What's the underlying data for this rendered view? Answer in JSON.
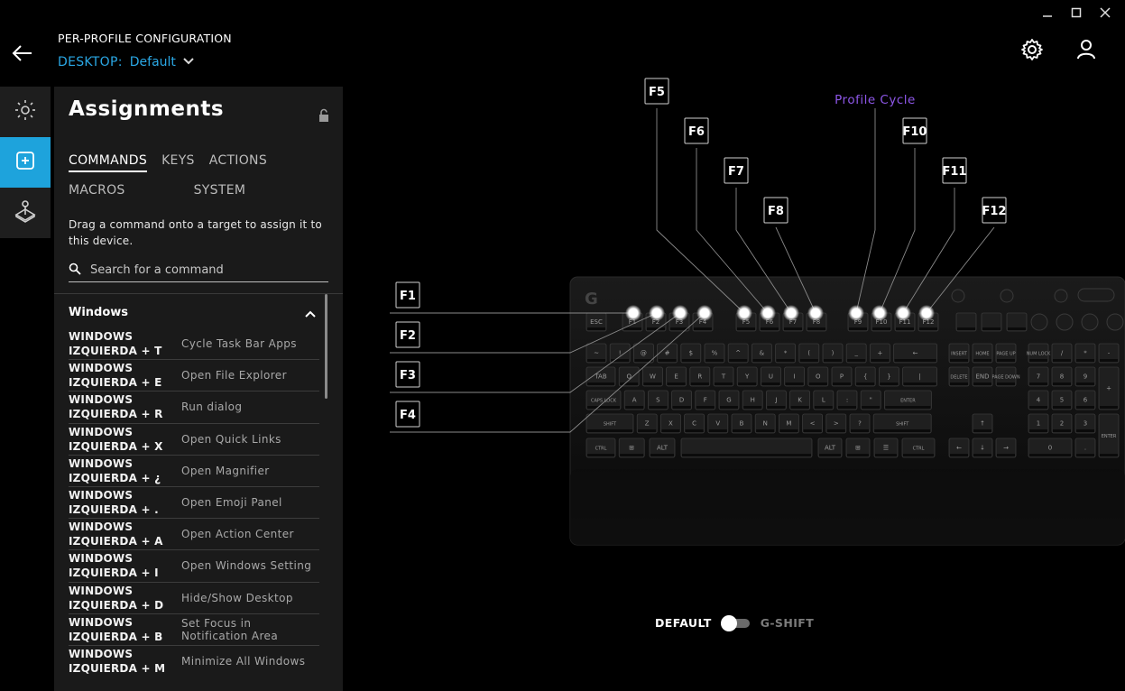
{
  "window": {
    "minimize_icon": "minimize-icon",
    "maximize_icon": "maximize-icon",
    "close_icon": "close-icon"
  },
  "header": {
    "title": "PER-PROFILE CONFIGURATION",
    "profile_prefix": "DESKTOP:",
    "profile_name": "Default",
    "accent_color": "#2aa7e4"
  },
  "sidebar": {
    "items": [
      {
        "name": "lighting",
        "icon": "sun-icon",
        "active": false
      },
      {
        "name": "assignments",
        "icon": "plus-square-icon",
        "active": true
      },
      {
        "name": "game-mode",
        "icon": "joystick-icon",
        "active": false
      }
    ],
    "active_color": "#1ea3dc"
  },
  "assignments": {
    "title": "Assignments",
    "tabs": [
      {
        "label": "COMMANDS",
        "active": true
      },
      {
        "label": "KEYS",
        "active": false
      },
      {
        "label": "ACTIONS",
        "active": false
      },
      {
        "label": "MACROS",
        "active": false
      },
      {
        "label": "SYSTEM",
        "active": false
      }
    ],
    "hint": "Drag a command onto a target to assign it to this device.",
    "search_placeholder": "Search for a command",
    "group": "Windows",
    "commands": [
      {
        "keys": "WINDOWS\nIZQUIERDA + T",
        "desc": "Cycle Task Bar Apps"
      },
      {
        "keys": "WINDOWS\nIZQUIERDA + E",
        "desc": "Open File Explorer"
      },
      {
        "keys": "WINDOWS\nIZQUIERDA + R",
        "desc": "Run dialog"
      },
      {
        "keys": "WINDOWS\nIZQUIERDA + X",
        "desc": "Open Quick Links"
      },
      {
        "keys": "WINDOWS\nIZQUIERDA + ¿",
        "desc": "Open Magnifier"
      },
      {
        "keys": "WINDOWS\nIZQUIERDA + .",
        "desc": "Open Emoji Panel"
      },
      {
        "keys": "WINDOWS\nIZQUIERDA + A",
        "desc": "Open Action Center"
      },
      {
        "keys": "WINDOWS\nIZQUIERDA + I",
        "desc": "Open Windows Setting"
      },
      {
        "keys": "WINDOWS\nIZQUIERDA + D",
        "desc": "Hide/Show Desktop"
      },
      {
        "keys": "WINDOWS\nIZQUIERDA + B",
        "desc": "Set Focus in Notification Area"
      },
      {
        "keys": "WINDOWS\nIZQUIERDA + M",
        "desc": "Minimize All Windows"
      }
    ]
  },
  "keyboard": {
    "callouts": [
      "F1",
      "F2",
      "F3",
      "F4",
      "F5",
      "F6",
      "F7",
      "F8",
      "F10",
      "F11",
      "F12"
    ],
    "profile_cycle_label": "Profile Cycle",
    "profile_cycle_color": "#8e57e8",
    "key_labels": {
      "row_fn": [
        "ESC",
        "F1",
        "F2",
        "F3",
        "F4",
        "F5",
        "F6",
        "F7",
        "F8",
        "F9",
        "F10",
        "F11",
        "F12"
      ],
      "row_1": [
        "~",
        "!",
        "@",
        "#",
        "$",
        "%",
        "^",
        "&",
        "*",
        "(",
        ")",
        "_",
        "+",
        "←",
        "INSERT",
        "HOME",
        "PAGE UP",
        "NUM LOCK",
        "/",
        "*",
        "-"
      ],
      "row_2": [
        "TAB",
        "Q",
        "W",
        "E",
        "R",
        "T",
        "Y",
        "U",
        "I",
        "O",
        "P",
        "{",
        "}",
        "|",
        "DELETE",
        "END",
        "PAGE DOWN",
        "7",
        "8",
        "9",
        "+"
      ],
      "row_3": [
        "CAPS LOCK",
        "A",
        "S",
        "D",
        "F",
        "G",
        "H",
        "J",
        "K",
        "L",
        ":",
        "\"",
        "ENTER",
        "4",
        "5",
        "6"
      ],
      "row_4": [
        "SHIFT",
        "Z",
        "X",
        "C",
        "V",
        "B",
        "N",
        "M",
        "<",
        ">",
        "?",
        "SHIFT",
        "↑",
        "1",
        "2",
        "3",
        "ENTER"
      ],
      "row_5": [
        "CTRL",
        "⊞",
        "ALT",
        "ALT",
        "⊞",
        "☰",
        "CTRL",
        "←",
        "↓",
        "→",
        "0",
        "."
      ]
    }
  },
  "mode_toggle": {
    "left": "DEFAULT",
    "right": "G-SHIFT",
    "value": "DEFAULT"
  },
  "top_icons": {
    "settings_icon": "gear-icon",
    "account_icon": "user-icon",
    "back_icon": "back-arrow-icon"
  }
}
